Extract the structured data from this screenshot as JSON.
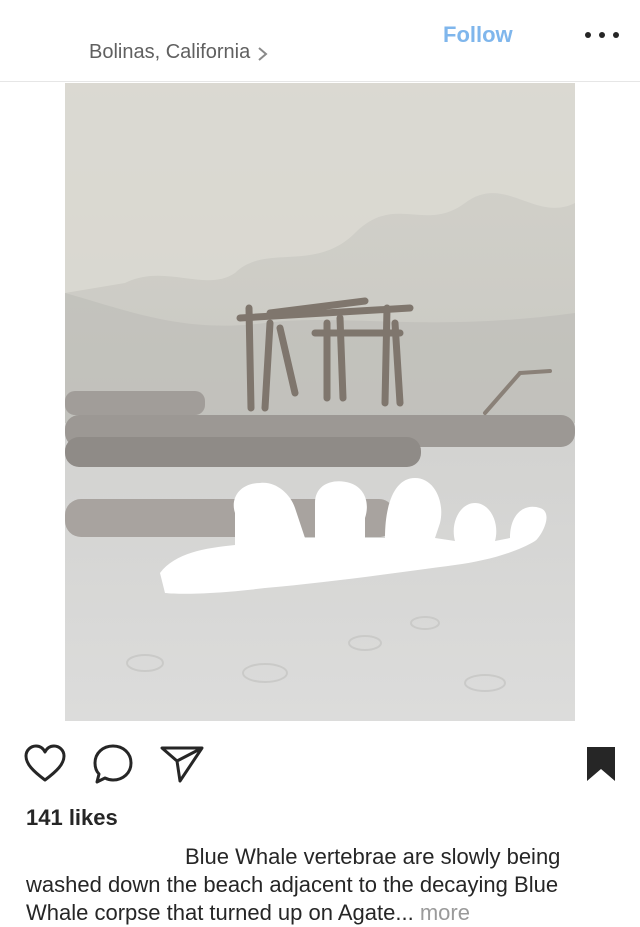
{
  "header": {
    "username": "",
    "location": "Bolinas, California",
    "follow_label": "Follow",
    "more_icon": "ellipsis-icon"
  },
  "post": {
    "photo_subject": "driftwood-fort-and-whale-vertebrae-on-beach",
    "likes_text": "141 likes",
    "caption_username": "",
    "caption_text": "Blue Whale vertebrae are slowly being washed down the beach adjacent to the decaying Blue Whale corpse that turned up on Agate...",
    "more_label": "more"
  },
  "actions": {
    "like_icon": "heart-icon",
    "comment_icon": "comment-bubble-icon",
    "share_icon": "paper-plane-icon",
    "save_icon": "bookmark-icon"
  },
  "colors": {
    "follow": "#7fb6ec",
    "text": "#262626",
    "secondary_text": "#606060",
    "more_link": "#9a9a9a",
    "divider": "#e6e6e6"
  }
}
